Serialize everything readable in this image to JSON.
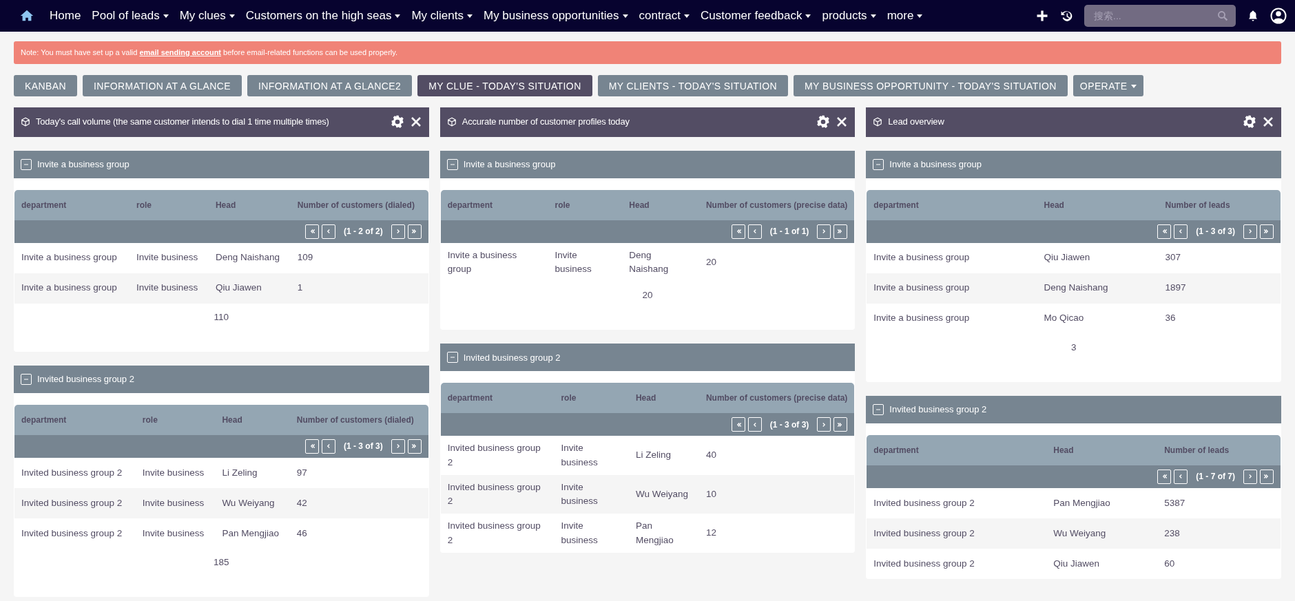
{
  "navbar": {
    "items": [
      {
        "label": "Home",
        "dropdown": false
      },
      {
        "label": "Pool of leads",
        "dropdown": true
      },
      {
        "label": "My clues",
        "dropdown": true
      },
      {
        "label": "Customers on the high seas",
        "dropdown": true
      },
      {
        "label": "My clients",
        "dropdown": true
      },
      {
        "label": "My business opportunities",
        "dropdown": true
      },
      {
        "label": "contract",
        "dropdown": true
      },
      {
        "label": "Customer feedback",
        "dropdown": true
      },
      {
        "label": "products",
        "dropdown": true
      },
      {
        "label": "more",
        "dropdown": true
      }
    ],
    "search": {
      "placeholder": "搜索..."
    }
  },
  "notice": {
    "before": "Note: You must have set up a valid ",
    "link": "email sending account",
    "after": " before email-related functions can be used properly."
  },
  "tabs": [
    {
      "label": "KANBAN",
      "selected": false
    },
    {
      "label": "INFORMATION AT A GLANCE",
      "selected": false
    },
    {
      "label": "INFORMATION AT A GLANCE2",
      "selected": false
    },
    {
      "label": "MY CLUE - TODAY'S SITUATION",
      "selected": true
    },
    {
      "label": "MY CLIENTS - TODAY'S SITUATION",
      "selected": false
    },
    {
      "label": "MY BUSINESS OPPORTUNITY - TODAY'S SITUATION",
      "selected": false
    }
  ],
  "operate_button": "OPERATE",
  "dashlets": [
    {
      "title": "Today's call volume (the same customer intends to dial 1 time multiple times)",
      "groups": [
        {
          "title": "Invite a business group",
          "columns": [
            "department",
            "role",
            "Head",
            "Number of customers (dialed)"
          ],
          "pager": "(1 - 2 of 2)",
          "rows": [
            [
              "Invite a business group",
              "Invite business",
              "Deng Naishang",
              "109"
            ],
            [
              "Invite a business group",
              "Invite business",
              "Qiu Jiawen",
              "1"
            ]
          ],
          "total": "110"
        },
        {
          "title": "Invited business group 2",
          "columns": [
            "department",
            "role",
            "Head",
            "Number of customers (dialed)"
          ],
          "pager": "(1 - 3 of 3)",
          "rows": [
            [
              "Invited business group 2",
              "Invite business",
              "Li Zeling",
              "97"
            ],
            [
              "Invited business group 2",
              "Invite business",
              "Wu Weiyang",
              "42"
            ],
            [
              "Invited business group 2",
              "Invite business",
              "Pan Mengjiao",
              "46"
            ]
          ],
          "total": "185"
        }
      ]
    },
    {
      "title": "Accurate number of customer profiles today",
      "groups": [
        {
          "title": "Invite a business group",
          "columns": [
            "department",
            "role",
            "Head",
            "Number of customers (precise data)"
          ],
          "pager": "(1 - 1 of 1)",
          "rows": [
            [
              "Invite a business group",
              "Invite business",
              "Deng Naishang",
              "20"
            ]
          ],
          "total": "20"
        },
        {
          "title": "Invited business group 2",
          "columns": [
            "department",
            "role",
            "Head",
            "Number of customers (precise data)"
          ],
          "pager": "(1 - 3 of 3)",
          "rows": [
            [
              "Invited business group 2",
              "Invite business",
              "Li Zeling",
              "40"
            ],
            [
              "Invited business group 2",
              "Invite business",
              "Wu Weiyang",
              "10"
            ],
            [
              "Invited business group 2",
              "Invite business",
              "Pan Mengjiao",
              "12"
            ]
          ]
        }
      ]
    },
    {
      "title": "Lead overview",
      "groups": [
        {
          "title": "Invite a business group",
          "columns": [
            "department",
            "Head",
            "Number of leads"
          ],
          "pager": "(1 - 3 of 3)",
          "rows": [
            [
              "Invite a business group",
              "Qiu Jiawen",
              "307"
            ],
            [
              "Invite a business group",
              "Deng Naishang",
              "1897"
            ],
            [
              "Invite a business group",
              "Mo Qicao",
              "36"
            ]
          ],
          "total": "3"
        },
        {
          "title": "Invited business group 2",
          "columns": [
            "department",
            "Head",
            "Number of leads"
          ],
          "pager": "(1 - 7 of 7)",
          "rows": [
            [
              "Invited business group 2",
              "Pan Mengjiao",
              "5387"
            ],
            [
              "Invited business group 2",
              "Wu Weiyang",
              "238"
            ],
            [
              "Invited business group 2",
              "Qiu Jiawen",
              "60"
            ]
          ]
        }
      ]
    }
  ]
}
